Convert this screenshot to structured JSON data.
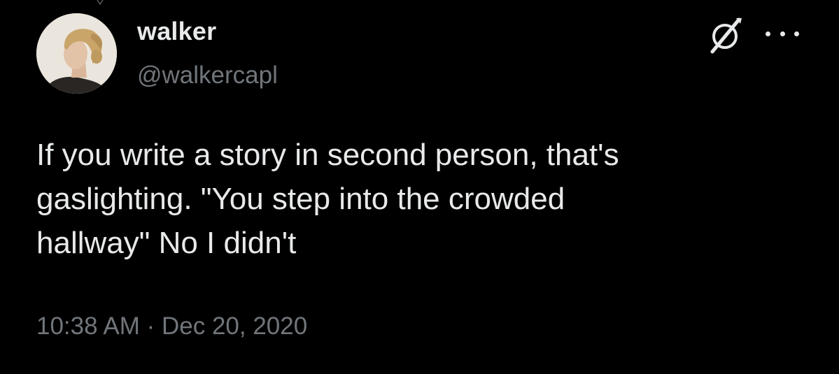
{
  "tweet": {
    "author": {
      "display_name": "walker",
      "handle": "@walkercapl"
    },
    "text_lines": [
      "If you write a story in second person, that's",
      "gaslighting. \"You step into the crowded",
      "hallway\" No I didn't"
    ],
    "timestamp": "10:38 AM · Dec 20, 2020"
  },
  "icons": {
    "avatar": "user-avatar",
    "grok": "grok-icon",
    "more": "more-icon"
  },
  "colors": {
    "background": "#000000",
    "primary_text": "#e7e9ea",
    "secondary_text": "#71767b"
  }
}
